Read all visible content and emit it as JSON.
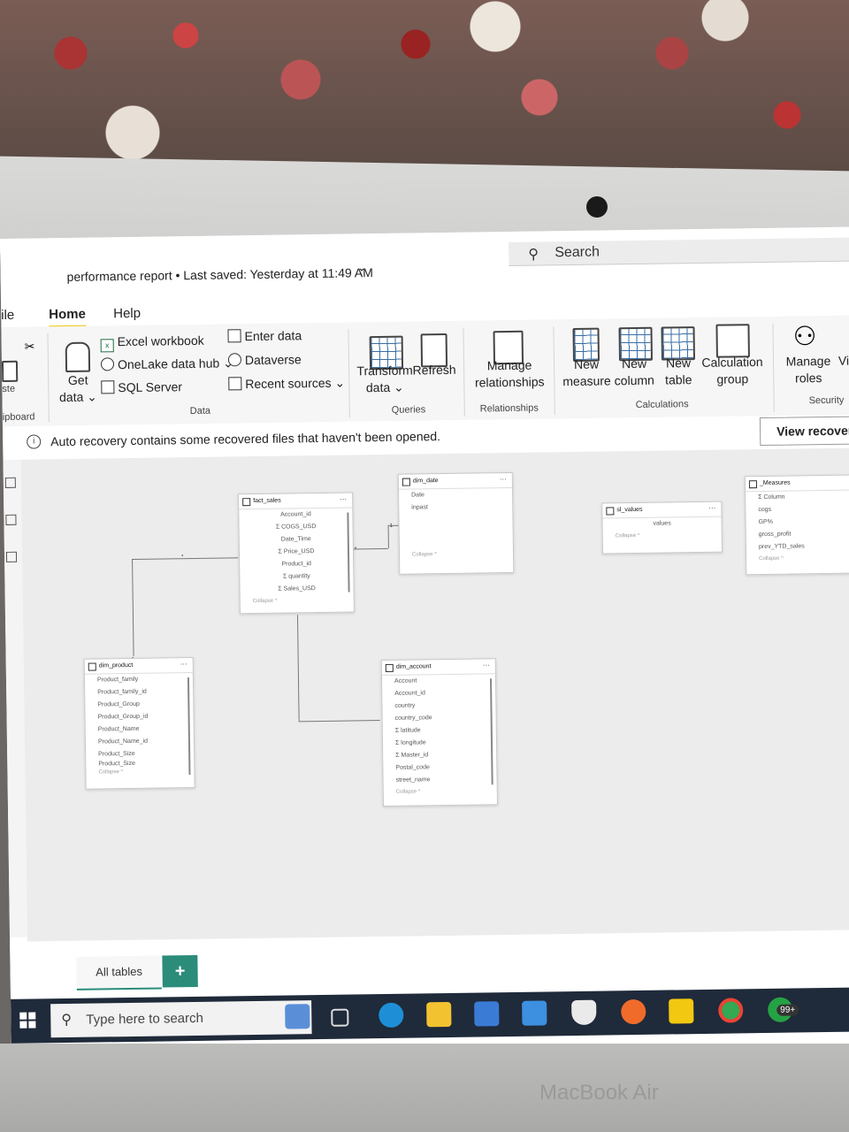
{
  "window": {
    "title": "performance report • Last saved: Yesterday at 11:49 AM",
    "title_caret": "⌄",
    "search_placeholder": "Search"
  },
  "tabs": [
    "ile",
    "Home",
    "Help"
  ],
  "ribbon": {
    "clipboard": {
      "label": "ipboard",
      "paste": "ste"
    },
    "get_data": "Get\ndata ⌄",
    "data_sources": [
      "Excel workbook",
      "OneLake data hub ⌄",
      "SQL Server"
    ],
    "data_sources2": [
      "Enter data",
      "Dataverse",
      "Recent sources ⌄"
    ],
    "data_group": "Data",
    "transform": "Transform\ndata ⌄",
    "refresh": "Refresh",
    "queries_group": "Queries",
    "manage_rel": "Manage\nrelationships",
    "relationships_group": "Relationships",
    "new_measure": "New\nmeasure",
    "new_column": "New\ncolumn",
    "new_table": "New\ntable",
    "calc_group": "Calculation\ngroup",
    "calculations_group": "Calculations",
    "manage_roles": "Manage\nroles",
    "view_as": "Vi",
    "security_group": "Security"
  },
  "infobar": {
    "message": "Auto recovery contains some recovered files that haven't been opened.",
    "button": "View recover"
  },
  "tables": {
    "fact_sales": {
      "name": "fact_sales",
      "fields": [
        "Account_id",
        "Σ COGS_USD",
        "Date_Time",
        "Σ Price_USD",
        "Product_id",
        "Σ quantity",
        "Σ Sales_USD"
      ],
      "collapse": "Collapse ^"
    },
    "dim_date": {
      "name": "dim_date",
      "fields": [
        "Date",
        "inpast"
      ],
      "collapse": "Collapse ^"
    },
    "sl_values": {
      "name": "sl_values",
      "fields": [
        "values"
      ],
      "collapse": "Collapse ^"
    },
    "measures": {
      "name": "_Measures",
      "fields": [
        "Σ Column",
        "cogs",
        "GP%",
        "gross_profit",
        "prev_YTD_sales"
      ],
      "collapse": "Collapse ^"
    },
    "dim_product": {
      "name": "dim_product",
      "fields": [
        "Product_family",
        "Product_family_id",
        "Product_Group",
        "Product_Group_id",
        "Product_Name",
        "Product_Name_id",
        "Product_Size",
        "Product_Size"
      ],
      "collapse": "Collapse ^"
    },
    "dim_account": {
      "name": "dim_account",
      "fields": [
        "Account",
        "Account_id",
        "country",
        "country_code",
        "Σ latitude",
        "Σ longitude",
        "Σ Master_id",
        "Postal_code",
        "street_name"
      ],
      "collapse": "Collapse ^"
    }
  },
  "relationship_labels": {
    "one": "1",
    "many": "*"
  },
  "bottom": {
    "tab_all": "All tables",
    "add": "+"
  },
  "taskbar": {
    "search_placeholder": "Type here to search",
    "badge": "99+"
  },
  "device_label": "MacBook Air"
}
